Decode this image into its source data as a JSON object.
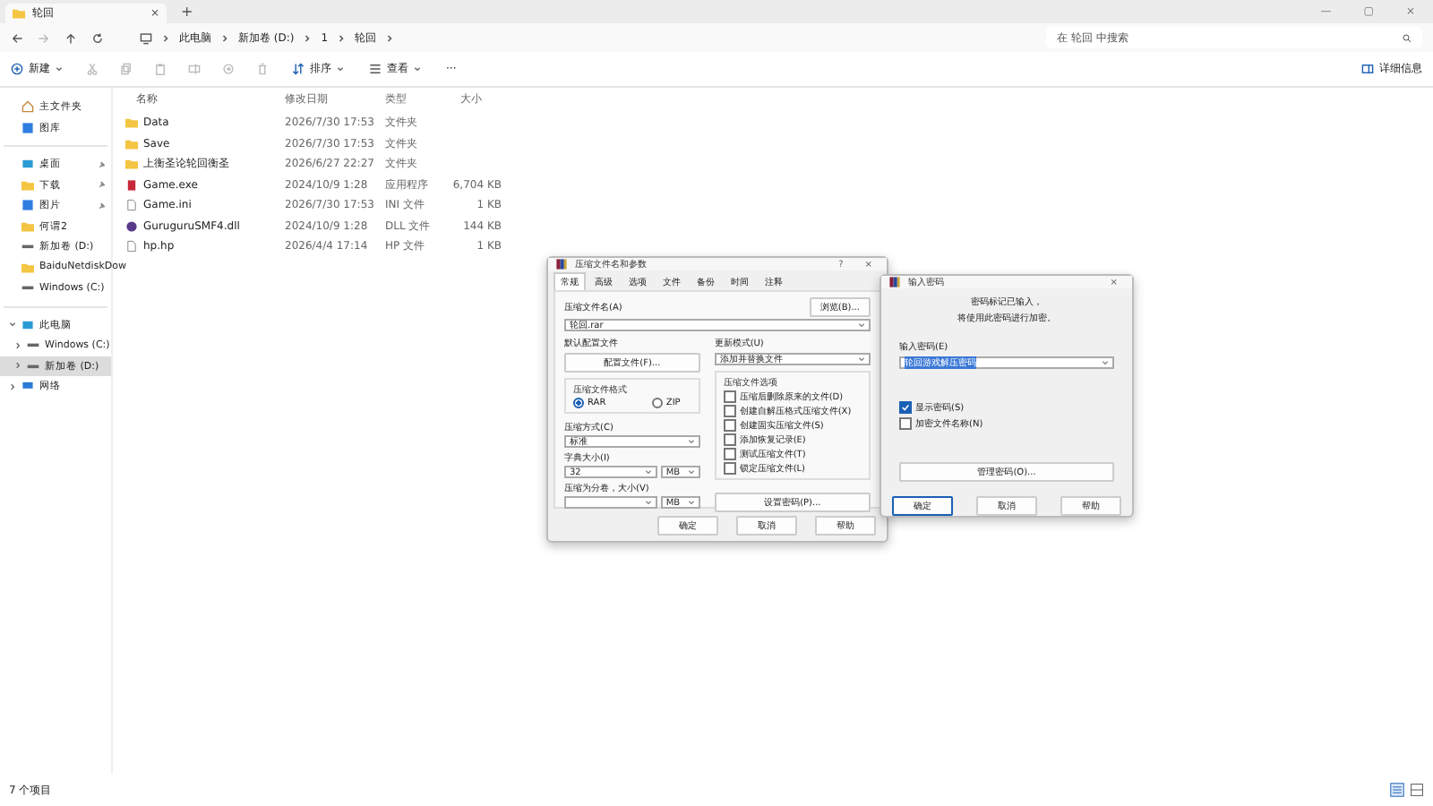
{
  "window": {
    "tab_title": "轮回",
    "tab_close": "×",
    "new_tab": "+",
    "controls": [
      "—",
      "▢",
      "×"
    ]
  },
  "nav": {
    "breadcrumbs": [
      "此电脑",
      "新加卷 (D:)",
      "1",
      "轮回"
    ],
    "search": {
      "placeholder": "在 轮回 中搜索"
    }
  },
  "toolbar": {
    "new": "新建",
    "sort": "排序",
    "view": "查看",
    "more": "···",
    "details": "详细信息"
  },
  "sidebar": {
    "quick": [
      {
        "label": "主文件夹",
        "kind": "home",
        "pinned": false
      },
      {
        "label": "图库",
        "kind": "gallery",
        "pinned": false
      },
      {
        "label": "桌面",
        "kind": "desktop",
        "pinned": true
      },
      {
        "label": "下载",
        "kind": "folder",
        "pinned": true
      },
      {
        "label": "图片",
        "kind": "gallery",
        "pinned": true
      },
      {
        "label": "何谓2",
        "kind": "folder",
        "pinned": false
      },
      {
        "label": "新加卷 (D:)",
        "kind": "drive",
        "pinned": false
      },
      {
        "label": "BaiduNetdiskDow",
        "kind": "folder",
        "pinned": false
      },
      {
        "label": "Windows (C:)",
        "kind": "drive",
        "pinned": false
      }
    ],
    "tree": [
      {
        "label": "此电脑",
        "kind": "desktop",
        "expanded": true,
        "selected": false,
        "children": [
          {
            "label": "Windows (C:)",
            "expanded": false,
            "selected": false
          },
          {
            "label": "新加卷 (D:)",
            "expanded": false,
            "selected": true
          }
        ]
      },
      {
        "label": "网络",
        "kind": "network",
        "expanded": false,
        "selected": false
      }
    ]
  },
  "table": {
    "columns": [
      "名称",
      "修改日期",
      "类型",
      "大小"
    ],
    "rows": [
      {
        "kind": "folder",
        "name": "Data",
        "date": "2026/7/30 17:53",
        "type": "文件夹"
      },
      {
        "kind": "folder",
        "name": "Save",
        "date": "2026/7/30 17:53",
        "type": "文件夹"
      },
      {
        "kind": "folder",
        "name": "上衡圣论轮回衡圣",
        "date": "2026/6/27 22:27",
        "type": "文件夹"
      },
      {
        "kind": "app",
        "name": "Game.exe",
        "date": "2024/10/9 1:28",
        "type": "应用程序",
        "size": "6,704 KB"
      },
      {
        "kind": "document",
        "name": "Game.ini",
        "date": "2026/7/30 17:53",
        "type": "INI 文件",
        "size": "1 KB"
      },
      {
        "kind": "library",
        "name": "GuruguruSMF4.dll",
        "date": "2024/10/9 1:28",
        "type": "DLL 文件",
        "size": "144 KB"
      },
      {
        "kind": "document",
        "name": "hp.hp",
        "date": "2026/4/4 17:14",
        "type": "HP 文件",
        "size": "1 KB"
      }
    ]
  },
  "status_bar": {
    "count": "7 个项目"
  },
  "archive_dialog": {
    "title": "压缩文件名和参数",
    "help": "?",
    "close": "×",
    "tabs": [
      {
        "label": "常规",
        "selected": true
      },
      {
        "label": "高级",
        "selected": false
      },
      {
        "label": "选项",
        "selected": false
      },
      {
        "label": "文件",
        "selected": false
      },
      {
        "label": "备份",
        "selected": false
      },
      {
        "label": "时间",
        "selected": false
      },
      {
        "label": "注释",
        "selected": false
      }
    ],
    "archive_name_label": "压缩文件名(A)",
    "browse": "浏览(B)...",
    "archive_name": "轮回.rar",
    "profile_label": "默认配置文件",
    "profile_button": "配置文件(F)...",
    "update_label": "更新模式(U)",
    "update_value": "添加并替换文件",
    "format_label": "压缩文件格式",
    "formats": [
      {
        "label": "RAR",
        "selected": true
      },
      {
        "label": "ZIP",
        "selected": false
      }
    ],
    "method_label": "压缩方式(C)",
    "method": "标准",
    "dict_label": "字典大小(I)",
    "dict": "32",
    "dict_unit": "MB",
    "volume_label": "压缩为分卷，大小(V)",
    "volume_unit": "MB",
    "options_label": "压缩文件选项",
    "options": [
      {
        "label": "压缩后删除原来的文件(D)",
        "checked": false
      },
      {
        "label": "创建自解压格式压缩文件(X)",
        "checked": false
      },
      {
        "label": "创建固实压缩文件(S)",
        "checked": false
      },
      {
        "label": "添加恢复记录(E)",
        "checked": false
      },
      {
        "label": "测试压缩文件(T)",
        "checked": false
      },
      {
        "label": "锁定压缩文件(L)",
        "checked": false
      }
    ],
    "password_button": "设置密码(P)...",
    "buttons": [
      "确定",
      "取消",
      "帮助"
    ]
  },
  "password_dialog": {
    "title": "输入密码",
    "close": "×",
    "message_lines": [
      "密码标记已输入，",
      "将使用此密码进行加密。"
    ],
    "password_label": "输入密码(E)",
    "password": "轮回游戏解压密码",
    "options": [
      {
        "label": "显示密码(S)",
        "checked": true
      },
      {
        "label": "加密文件名称(N)",
        "checked": false
      }
    ],
    "manage": "管理密码(O)...",
    "buttons": [
      "确定",
      "取消",
      "帮助"
    ]
  }
}
